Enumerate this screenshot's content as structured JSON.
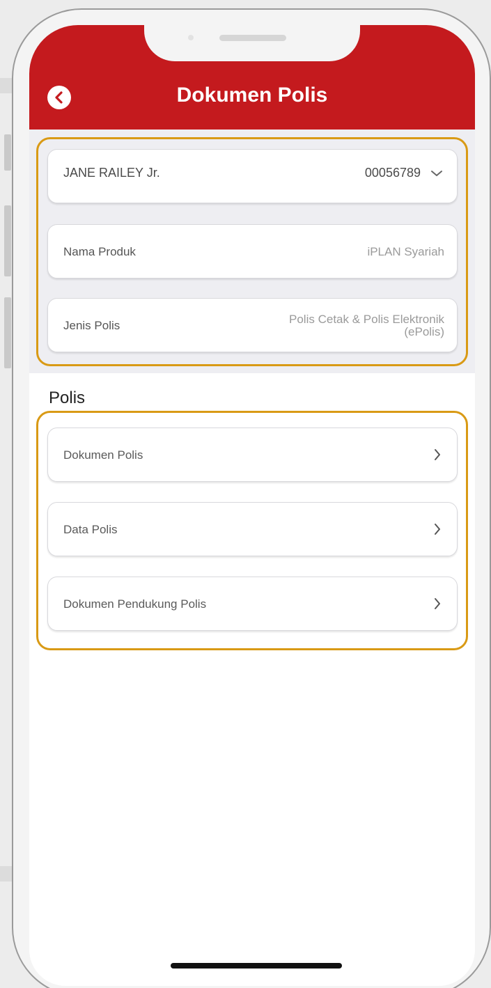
{
  "header": {
    "title": "Dokumen Polis"
  },
  "policy_selector": {
    "holder_name": "JANE RAILEY Jr.",
    "policy_number": "00056789"
  },
  "product": {
    "label": "Nama Produk",
    "value": "iPLAN Syariah"
  },
  "policy_type": {
    "label": "Jenis Polis",
    "value_line1": "Polis Cetak & Polis Elektronik",
    "value_line2": "(ePolis)"
  },
  "section": {
    "title": "Polis"
  },
  "menu": [
    {
      "label": "Dokumen Polis"
    },
    {
      "label": "Data Polis"
    },
    {
      "label": "Dokumen Pendukung Polis"
    }
  ],
  "colors": {
    "brand_red": "#c41a1e",
    "highlight": "#d99a15"
  },
  "icons": {
    "back": "chevron-left-circle-icon",
    "dropdown": "chevron-down-icon",
    "nav": "chevron-right-icon"
  }
}
